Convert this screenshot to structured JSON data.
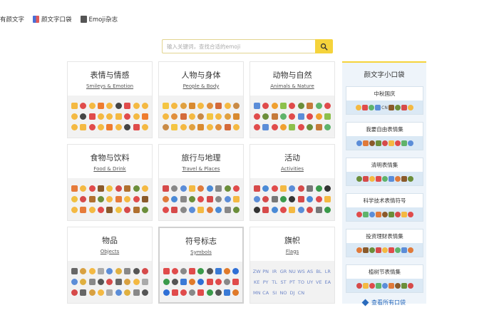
{
  "nav": [
    {
      "label": "有颜文字",
      "icon": ""
    },
    {
      "label": "颜文字口袋",
      "icon": "book-icon"
    },
    {
      "label": "Emoji杂志",
      "icon": "magazine-icon"
    }
  ],
  "search": {
    "placeholder": "输入关键词，查找合适的emoji"
  },
  "categories": [
    {
      "title": "表情与情感",
      "subtitle": "Smileys & Emotion",
      "colors": [
        "#f4b942",
        "#e04b4b",
        "#f4b942",
        "#ee7c2f",
        "#f4b942",
        "#444",
        "#e04b4b",
        "#f4b942",
        "#f4b942"
      ]
    },
    {
      "title": "人物与身体",
      "subtitle": "People & Body",
      "colors": [
        "#f4c542",
        "#f4b942",
        "#e0a040",
        "#d88a30",
        "#f4b942",
        "#e08f3c",
        "#d46a3a",
        "#f4b942",
        "#c98a45"
      ]
    },
    {
      "title": "动物与自然",
      "subtitle": "Animals & Nature",
      "colors": [
        "#5b8dd8",
        "#e04b4b",
        "#f0a030",
        "#8cc04b",
        "#e04b4b",
        "#6b8e3a",
        "#c57a3a",
        "#5fb36b",
        "#e04b4b"
      ]
    },
    {
      "title": "食物与饮料",
      "subtitle": "Food & Drink",
      "colors": [
        "#e67b3a",
        "#f4b942",
        "#e04b4b",
        "#8a5a2b",
        "#f0c040",
        "#d64a4a",
        "#b0702f",
        "#6b8e3a",
        "#f4b942"
      ]
    },
    {
      "title": "旅行与地理",
      "subtitle": "Travel & Places",
      "colors": [
        "#d64a4a",
        "#888",
        "#5b8dd8",
        "#f4b942",
        "#e07a3a",
        "#4a8ad6",
        "#888",
        "#6b8e3a",
        "#e04b4b"
      ]
    },
    {
      "title": "活动",
      "subtitle": "Activities",
      "colors": [
        "#d64a4a",
        "#4a8ad6",
        "#e04b4b",
        "#f4b942",
        "#5b8dd8",
        "#d64a4a",
        "#777",
        "#3a9a4a",
        "#333"
      ]
    },
    {
      "title": "物品",
      "subtitle": "Objects",
      "colors": [
        "#666",
        "#d8a040",
        "#f4b942",
        "#aaa",
        "#5b8dd8",
        "#e0b040",
        "#888",
        "#555",
        "#d64a4a"
      ]
    },
    {
      "title": "符号标志",
      "subtitle": "Symbols",
      "colors": [
        "#e04b4b",
        "#e04b4b",
        "#888",
        "#e04b4b",
        "#3a9a4a",
        "#555",
        "#3a7ad6",
        "#e07a2a",
        "#2f6fd6"
      ]
    },
    {
      "title": "旗帜",
      "subtitle": "Flags",
      "flags": [
        "ZW",
        "PN",
        "IR",
        "GR",
        "NU",
        "WS",
        "AS",
        "BL",
        "LR",
        "KE",
        "PY",
        "TL",
        "ST",
        "PT",
        "TO",
        "UY",
        "VE",
        "EA",
        "MN",
        "CA",
        "SI",
        "NO",
        "DJ",
        "CN"
      ]
    }
  ],
  "sidebar": {
    "title": "颜文字小口袋",
    "packs": [
      {
        "name": "中秋国庆",
        "extra": "CN"
      },
      {
        "name": "我要自由表情集",
        "extra": ""
      },
      {
        "name": "清明表情集",
        "extra": ""
      },
      {
        "name": "科学技术表情符号",
        "extra": ""
      },
      {
        "name": "投资理财表情集",
        "extra": ""
      },
      {
        "name": "植树节表情集",
        "extra": ""
      }
    ],
    "view_all": "查看所有口袋"
  }
}
